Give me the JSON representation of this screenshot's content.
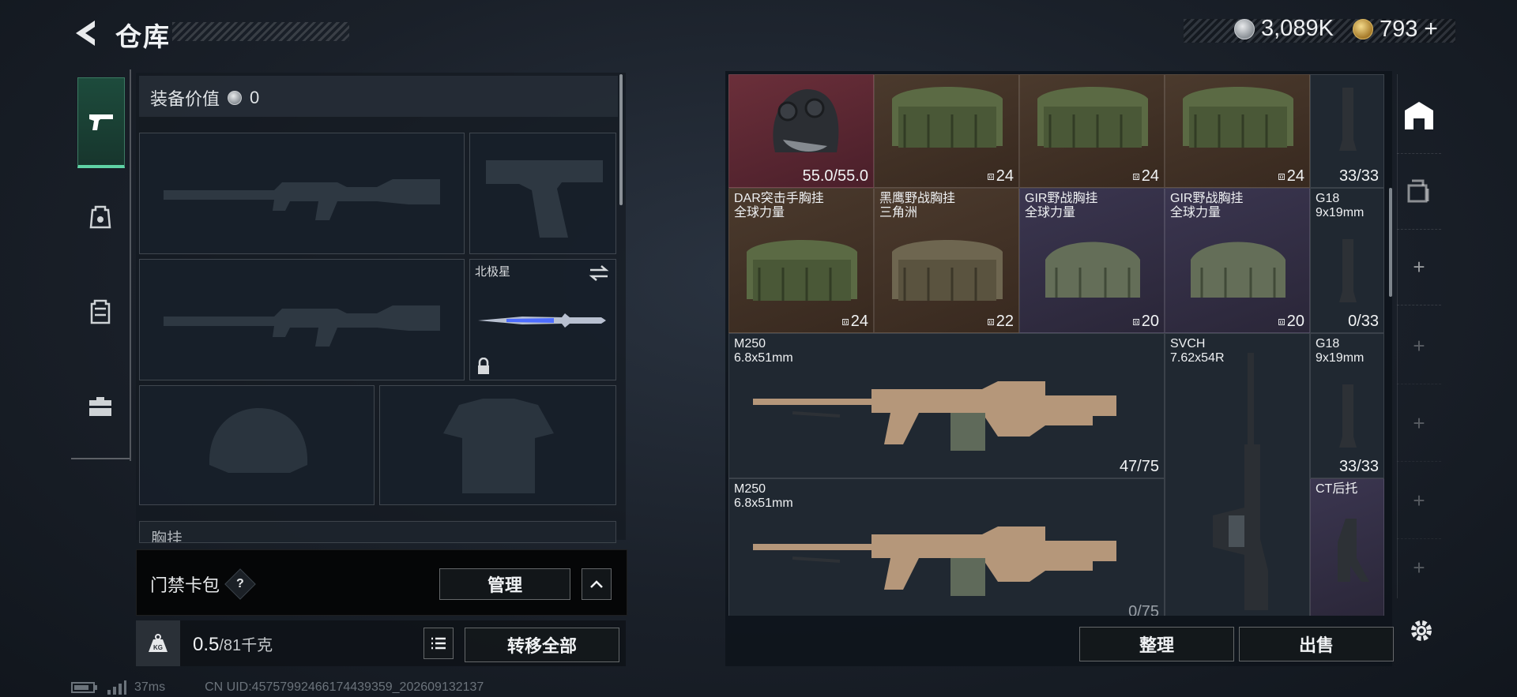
{
  "header": {
    "title": "仓库"
  },
  "currency": {
    "silver": "3,089K",
    "gold": "793",
    "gold_plus": "+"
  },
  "equipment": {
    "value_label": "装备价值",
    "value": "0",
    "melee_slot_label": "北极星",
    "chest_partial_label": "胸挂"
  },
  "card_pack": {
    "label": "门禁卡包",
    "help": "?",
    "manage_label": "管理"
  },
  "weight": {
    "value": "0.5",
    "capacity": "/81",
    "unit": "千克",
    "transfer_all_label": "转移全部",
    "kg_label": "KG"
  },
  "inventory": {
    "cells": [
      {
        "name": "",
        "count": "55.0/55.0",
        "style": "red"
      },
      {
        "name": "",
        "count": "24",
        "style": "brown",
        "grid": true
      },
      {
        "name": "",
        "count": "24",
        "style": "brown",
        "grid": true
      },
      {
        "name": "",
        "count": "24",
        "style": "brown",
        "grid": true
      },
      {
        "name": "",
        "count": "33/33",
        "style": "dark"
      },
      {
        "name": "DAR突击手胸挂\n全球力量",
        "count": "24",
        "style": "brown",
        "grid": true
      },
      {
        "name": "黑鹰野战胸挂\n三角洲",
        "count": "22",
        "style": "brown",
        "grid": true
      },
      {
        "name": "GIR野战胸挂\n全球力量",
        "count": "20",
        "style": "purple",
        "grid": true
      },
      {
        "name": "GIR野战胸挂\n全球力量",
        "count": "20",
        "style": "purple",
        "grid": true
      },
      {
        "name": "G18\n9x19mm",
        "count": "0/33",
        "style": "dark"
      },
      {
        "name": "M250\n6.8x51mm",
        "count": "47/75",
        "style": "dark"
      },
      {
        "name": "SVCH\n7.62x54R",
        "count": "",
        "style": "dark"
      },
      {
        "name": "G18\n9x19mm",
        "count": "33/33",
        "style": "dark"
      },
      {
        "name": "M250\n6.8x51mm",
        "count": "0/75",
        "style": "dark"
      },
      {
        "name": "CT后托",
        "count": "",
        "style": "purple"
      }
    ],
    "sort_label": "整理",
    "sell_label": "出售"
  },
  "footer": {
    "ping": "37ms",
    "uid": "CN UID:4575799246617443935​9_202609132137"
  }
}
